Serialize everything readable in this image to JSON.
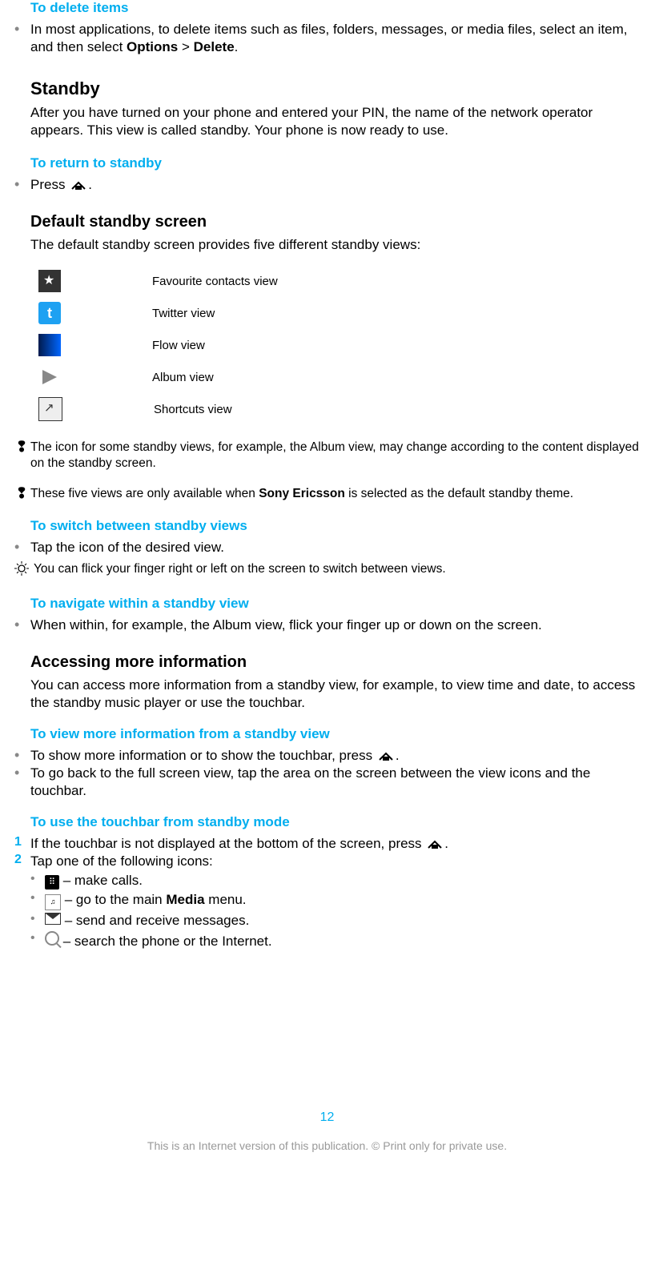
{
  "sections": {
    "delete": {
      "heading": "To delete items",
      "text_a": "In most applications, to delete items such as files, folders, messages, or media files, select an item, and then select ",
      "text_b": "Options",
      "text_c": " > ",
      "text_d": "Delete",
      "text_e": "."
    },
    "standby": {
      "heading": "Standby",
      "body": "After you have turned on your phone and entered your PIN, the name of the network operator appears. This view is called standby. Your phone is now ready to use."
    },
    "return": {
      "heading": "To return to standby",
      "text_a": "Press ",
      "text_b": "."
    },
    "default_screen": {
      "heading": "Default standby screen",
      "intro": "The default standby screen provides five different standby views:",
      "rows": [
        {
          "label": "Favourite contacts view"
        },
        {
          "label": "Twitter view"
        },
        {
          "label": "Flow view"
        },
        {
          "label": "Album view"
        },
        {
          "label": "Shortcuts view"
        }
      ],
      "note1": "The icon for some standby views, for example, the Album view, may change according to the content displayed on the standby screen.",
      "note2_a": "These five views are only available when ",
      "note2_b": "Sony Ericsson",
      "note2_c": " is selected as the default standby theme."
    },
    "switch": {
      "heading": "To switch between standby views",
      "bullet": "Tap the icon of the desired view.",
      "tip": "You can flick your finger right or left on the screen to switch between views."
    },
    "navigate": {
      "heading": "To navigate within a standby view",
      "bullet": "When within, for example, the Album view, flick your finger up or down on the screen."
    },
    "accessing": {
      "heading": "Accessing more information",
      "body": "You can access more information from a standby view, for example, to view time and date, to access the standby music player or use the touchbar."
    },
    "view_more": {
      "heading": "To view more information from a standby view",
      "b1_a": "To show more information or to show the touchbar, press ",
      "b1_b": ".",
      "b2": "To go back to the full screen view, tap the area on the screen between the view icons and the touchbar."
    },
    "touchbar": {
      "heading": "To use the touchbar from standby mode",
      "s1_a": "If the touchbar is not displayed at the bottom of the screen, press ",
      "s1_b": ".",
      "s2": "Tap one of the following icons:",
      "items": {
        "call": " – make calls.",
        "media_a": " – go to the main ",
        "media_b": "Media",
        "media_c": " menu.",
        "msg": " – send and receive messages.",
        "search": " – search the phone or the Internet."
      }
    }
  },
  "page_number": "12",
  "footer": "This is an Internet version of this publication. © Print only for private use."
}
